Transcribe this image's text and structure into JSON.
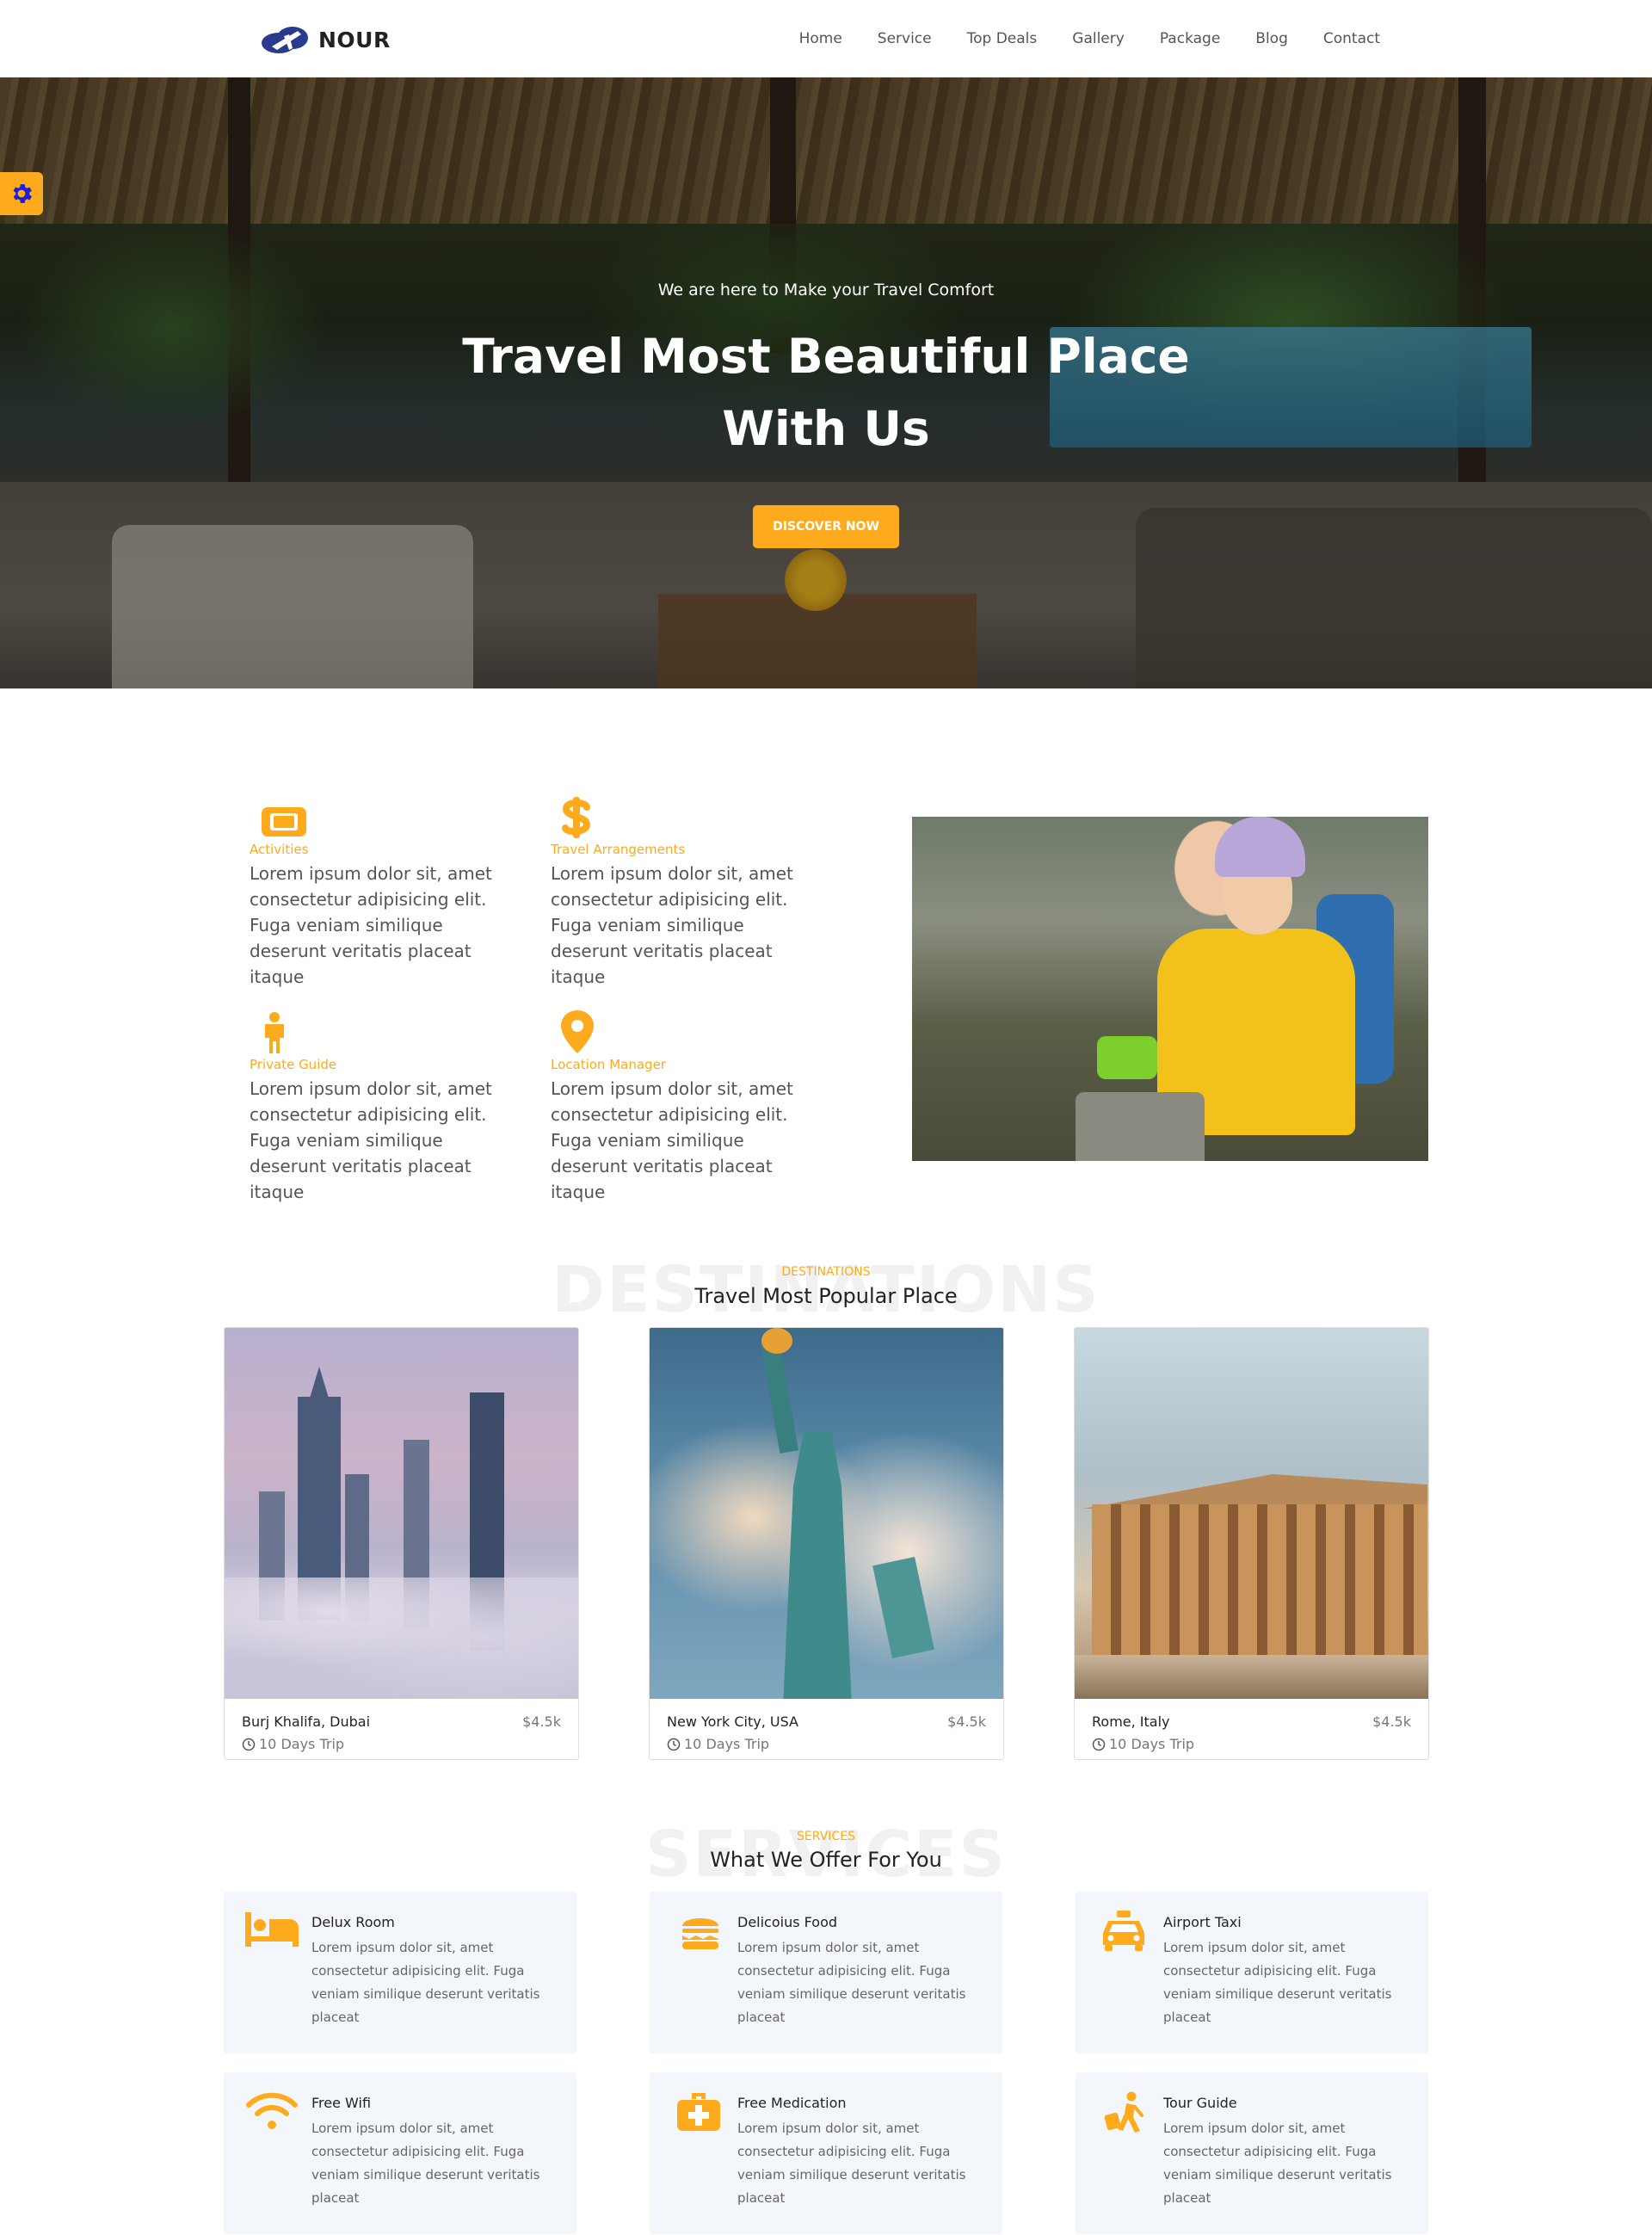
{
  "brand": {
    "name": "NOUR",
    "accent": "#fdab1c",
    "logo_color": "#2b3a8f"
  },
  "nav": {
    "items": [
      "Home",
      "Service",
      "Top Deals",
      "Gallery",
      "Package",
      "Blog",
      "Contact"
    ]
  },
  "settings": {
    "icon": "gear-icon"
  },
  "hero": {
    "subtitle": "We are here to Make your Travel Comfort",
    "title_line1": "Travel Most Beautiful Place",
    "title_line2": "With Us",
    "button": "DISCOVER NOW"
  },
  "features": [
    {
      "icon": "ticket-icon",
      "title": "Activities",
      "desc": "Lorem ipsum dolor sit, amet consectetur adipisicing elit. Fuga veniam similique deserunt veritatis placeat itaque"
    },
    {
      "icon": "dollar-icon",
      "title": "Travel Arrangements",
      "desc": "Lorem ipsum dolor sit, amet consectetur adipisicing elit. Fuga veniam similique deserunt veritatis placeat itaque"
    },
    {
      "icon": "person-icon",
      "title": "Private Guide",
      "desc": "Lorem ipsum dolor sit, amet consectetur adipisicing elit. Fuga veniam similique deserunt veritatis placeat itaque"
    },
    {
      "icon": "map-pin-icon",
      "title": "Location Manager",
      "desc": "Lorem ipsum dolor sit, amet consectetur adipisicing elit. Fuga veniam similique deserunt veritatis placeat itaque"
    }
  ],
  "destinations": {
    "bg_text": "DESTINATIONS",
    "kicker": "DESTINATIONS",
    "title": "Travel Most Popular Place",
    "cards": [
      {
        "name": "Burj Khalifa, Dubai",
        "price": "$4.5k",
        "trip": "10 Days Trip"
      },
      {
        "name": "New York City, USA",
        "price": "$4.5k",
        "trip": "10 Days Trip"
      },
      {
        "name": "Rome, Italy",
        "price": "$4.5k",
        "trip": "10 Days Trip"
      }
    ]
  },
  "services": {
    "bg_text": "SERVICES",
    "kicker": "SERVICES",
    "title": "What We Offer For You",
    "items": [
      {
        "icon": "bed-icon",
        "title": "Delux Room",
        "desc": "Lorem ipsum dolor sit, amet consectetur adipisicing elit. Fuga veniam similique deserunt veritatis placeat"
      },
      {
        "icon": "burger-icon",
        "title": "Delicoius Food",
        "desc": "Lorem ipsum dolor sit, amet consectetur adipisicing elit. Fuga veniam similique deserunt veritatis placeat"
      },
      {
        "icon": "taxi-icon",
        "title": "Airport Taxi",
        "desc": "Lorem ipsum dolor sit, amet consectetur adipisicing elit. Fuga veniam similique deserunt veritatis placeat"
      },
      {
        "icon": "wifi-icon",
        "title": "Free Wifi",
        "desc": "Lorem ipsum dolor sit, amet consectetur adipisicing elit. Fuga veniam similique deserunt veritatis placeat"
      },
      {
        "icon": "medkit-icon",
        "title": "Free Medication",
        "desc": "Lorem ipsum dolor sit, amet consectetur adipisicing elit. Fuga veniam similique deserunt veritatis placeat"
      },
      {
        "icon": "traveler-icon",
        "title": "Tour Guide",
        "desc": "Lorem ipsum dolor sit, amet consectetur adipisicing elit. Fuga veniam similique deserunt veritatis placeat"
      }
    ]
  }
}
